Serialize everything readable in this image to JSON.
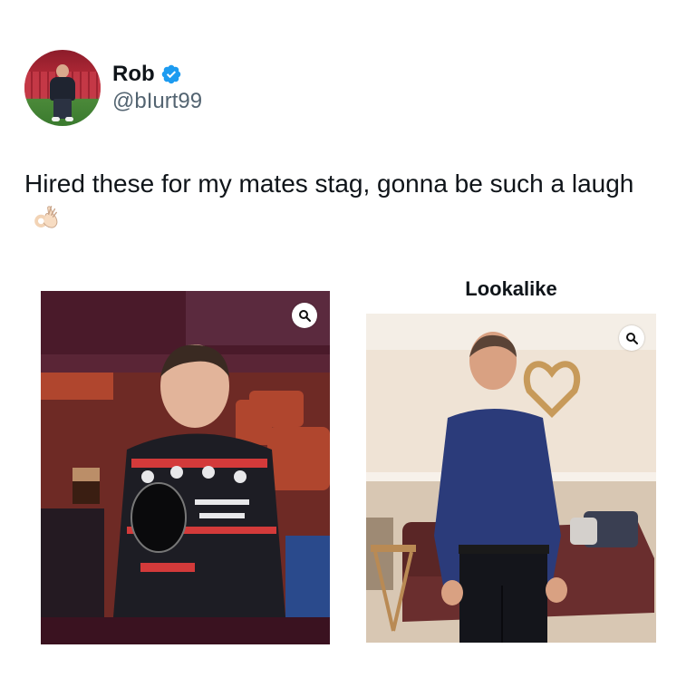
{
  "tweet": {
    "display_name": "Rob",
    "handle": "@bIurt99",
    "verified_icon": "verified-badge-icon",
    "text": "Hired these for my mates stag, gonna be such a laugh",
    "emoji": "ok-hand-emoji"
  },
  "media": {
    "right_label": "Lookalike",
    "zoom_icon": "search-icon"
  },
  "colors": {
    "verified": "#1d9bf0",
    "handle": "#536471",
    "text": "#0f1419"
  }
}
